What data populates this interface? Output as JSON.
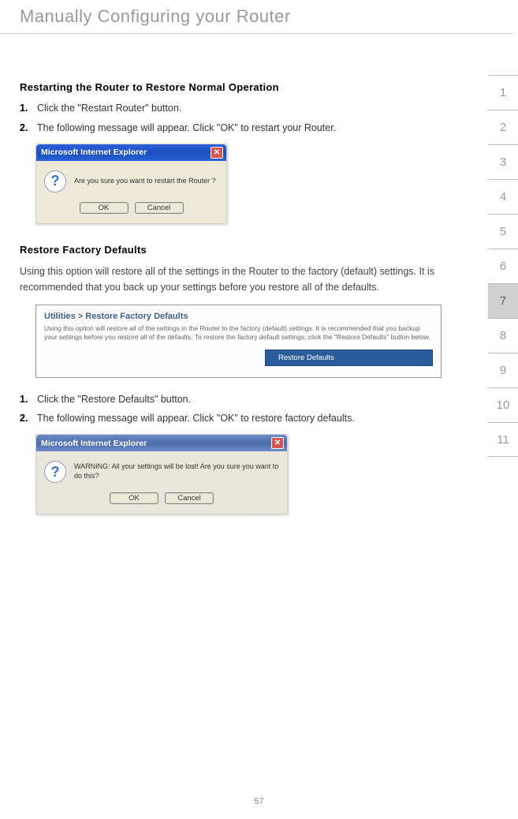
{
  "page": {
    "title": "Manually Configuring your Router",
    "number": "57"
  },
  "section1": {
    "heading": "Restarting the Router to Restore Normal Operation",
    "steps": [
      {
        "num": "1.",
        "text": "Click the \"Restart Router\" button."
      },
      {
        "num": "2.",
        "text": "The following message will appear. Click \"OK\" to restart your Router."
      }
    ]
  },
  "dialog1": {
    "title": "Microsoft Internet Explorer",
    "message": "Are you sure you want to restart the Router ?",
    "ok": "OK",
    "cancel": "Cancel"
  },
  "section2": {
    "heading": "Restore Factory Defaults",
    "body": "Using this option will restore all of the settings in the Router to the factory (default) settings. It is recommended that you back up your settings before you restore all of the defaults."
  },
  "util_panel": {
    "title": "Utilities > Restore Factory Defaults",
    "text": "Using this option will restore all of the settings in the Router to the factory (default) settings. It is recommended that you backup your settings before you restore all of the defaults. To restore the factory default settings, click the \"Restore Defaults\" button below.",
    "button": "Restore Defaults"
  },
  "section3": {
    "steps": [
      {
        "num": "1.",
        "text": "Click the \"Restore Defaults\" button."
      },
      {
        "num": "2.",
        "text": "The following message will appear. Click \"OK\" to restore factory defaults."
      }
    ]
  },
  "dialog2": {
    "title": "Microsoft Internet Explorer",
    "message": "WARNING: All your settings will be lost! Are you sure you want to do this?",
    "ok": "OK",
    "cancel": "Cancel"
  },
  "sidebar": {
    "items": [
      "1",
      "2",
      "3",
      "4",
      "5",
      "6",
      "7",
      "8",
      "9",
      "10",
      "11"
    ],
    "active_index": 6
  }
}
